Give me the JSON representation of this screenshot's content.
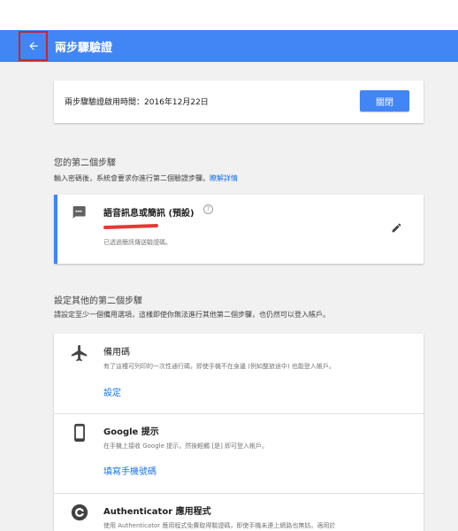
{
  "header": {
    "title": "兩步驟驗證",
    "back_icon": "arrow-left-icon",
    "color": "#4285f4"
  },
  "status": {
    "text": "兩步驟驗證啟用時間：2016年12月22日",
    "close_label": "關閉"
  },
  "second_step": {
    "heading": "您的第二個步驟",
    "description": "輸入密碼後，系統會要求你進行第二個驗證步驟。",
    "learn_more": "瞭解詳情",
    "title": "語音訊息或簡訊 (預設)",
    "help_icon": "?",
    "subtitle": "已透過簡訊傳送驗證碼。"
  },
  "other_steps": {
    "heading": "設定其他的第二個步驟",
    "description": "請設定至少一個備用選項，這樣即使你無法進行其他第二個步驟，也仍然可以登入帳戶。",
    "items": [
      {
        "icon": "airplane-icon",
        "title": "備用碼",
        "desc": "有了這種可列印的一次性通行碼，即使手機不在身邊 (例如整旅途中) 也能登入帳戶。",
        "link": "設定"
      },
      {
        "icon": "phone-icon",
        "title": "Google 提示",
        "desc": "在手機上接收 Google 提示，然後輕觸 [是] 即可登入帳戶。",
        "link": "填寫手機號碼"
      },
      {
        "icon": "authenticator-icon",
        "title": "Authenticator 應用程式",
        "desc": "使用 Authenticator 應用程式免費取得驗證碼，即使手機未連上網路也無妨。適用於",
        "link": ""
      }
    ]
  }
}
